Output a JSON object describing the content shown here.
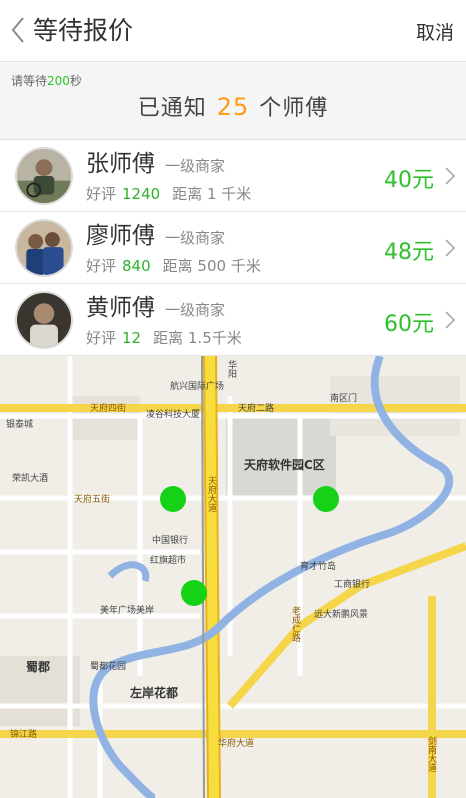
{
  "header": {
    "title": "等待报价",
    "cancel_label": "取消"
  },
  "wait": {
    "prefix": "请等待",
    "seconds": "200",
    "suffix": "秒"
  },
  "notify": {
    "prefix": "已通知",
    "count": "25",
    "suffix": "个师傅"
  },
  "masters": [
    {
      "name": "张师傅",
      "level": "一级商家",
      "review_label": "好评",
      "review_count": "1240",
      "distance": "距离 1 千米",
      "price": "40元"
    },
    {
      "name": "廖师傅",
      "level": "一级商家",
      "review_label": "好评",
      "review_count": "840",
      "distance": "距离 500 千米",
      "price": "48元"
    },
    {
      "name": "黄师傅",
      "level": "一级商家",
      "review_label": "好评",
      "review_count": "12",
      "distance": "距离 1.5千米",
      "price": "60元"
    }
  ],
  "map": {
    "labels": {
      "tfsc": "天府软件园C区",
      "tf4": "天府四街",
      "tf5": "天府五街",
      "tfdd": "天府大道",
      "tf2": "天府二路",
      "ylkj": "凌谷科技大厦",
      "zgyh": "中国银行",
      "hqcs": "红旗超市",
      "gsyh": "工商银行",
      "mnqzq": "美年广场美岸",
      "sdhd": "蜀都花园",
      "zahd": "左岸花都",
      "sj": "蜀郡",
      "ysj": "远大新鹏风景",
      "yhgc": "银泰城",
      "zhd": "华府大道",
      "lcrl": "老成仁路",
      "rbd": "荣凯大酒",
      "nqm": "南区门",
      "yczx": "育才竹岛",
      "hxgc": "航兴国际广场",
      "hsgd": "华阳",
      "xpm": "剑南大道",
      "jhr": "锦江路"
    }
  },
  "colors": {
    "accent_green": "#2fc02f",
    "count_orange": "#ff9b17",
    "pin": "#16d216"
  }
}
